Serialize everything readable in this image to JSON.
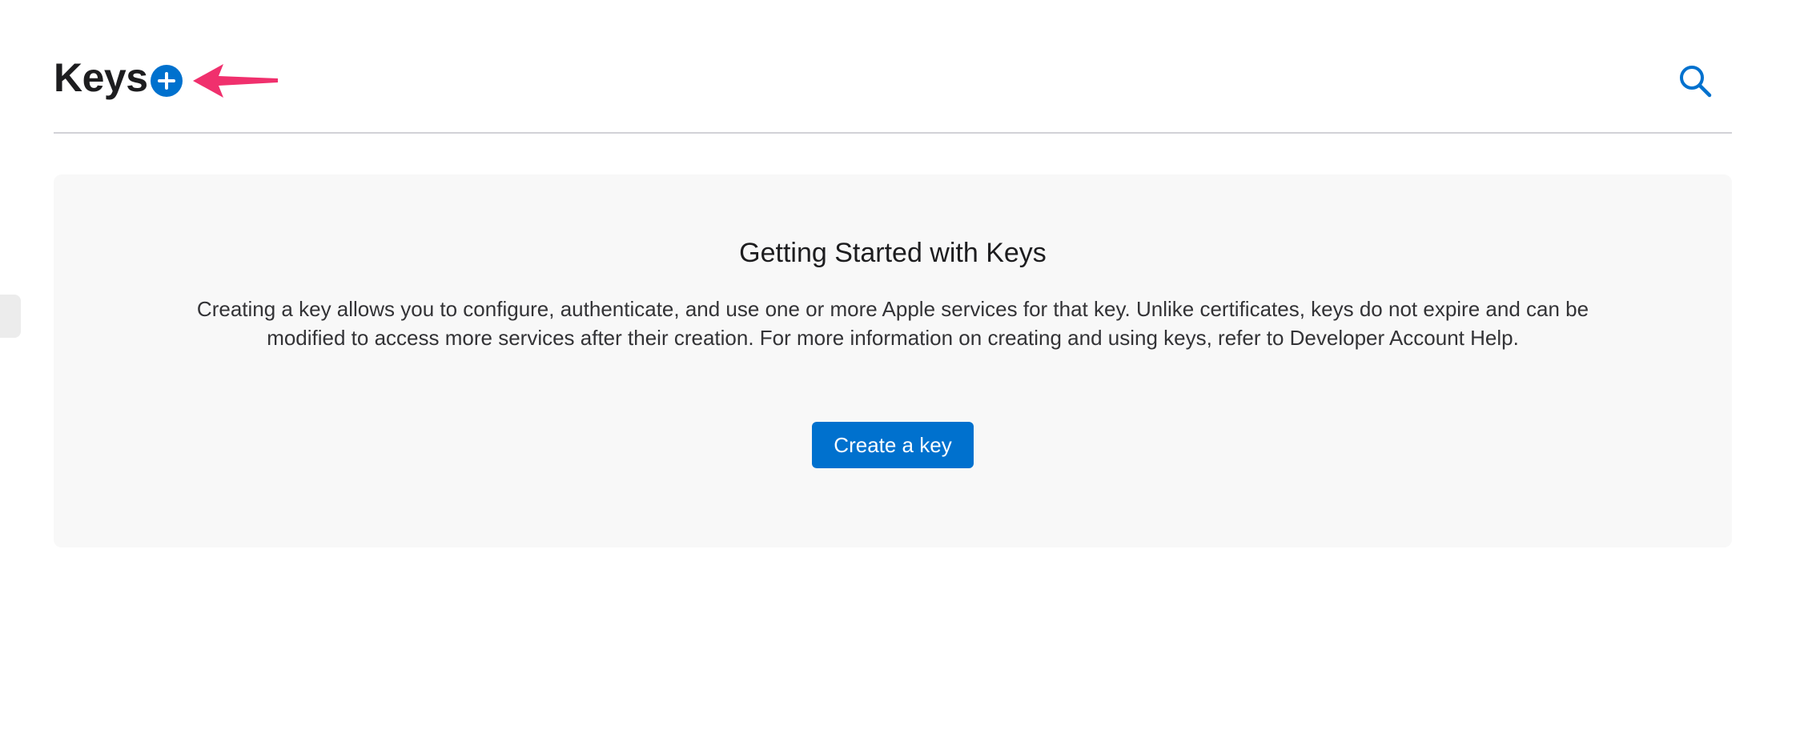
{
  "header": {
    "title": "Keys"
  },
  "empty_state": {
    "title": "Getting Started with Keys",
    "description": "Creating a key allows you to configure, authenticate, and use one or more Apple services for that key. Unlike certificates, keys do not expire and can be modified to access more services after their creation. For more information on creating and using keys, refer to Developer Account Help.",
    "create_label": "Create a key"
  },
  "icons": {
    "add": "plus-circle-icon",
    "search": "search-icon",
    "annotation": "arrow-left-icon"
  },
  "colors": {
    "accent": "#0071ce",
    "annotation_arrow": "#f0306d",
    "panel_background": "#f8f8f8",
    "divider": "#d2d2d7"
  }
}
